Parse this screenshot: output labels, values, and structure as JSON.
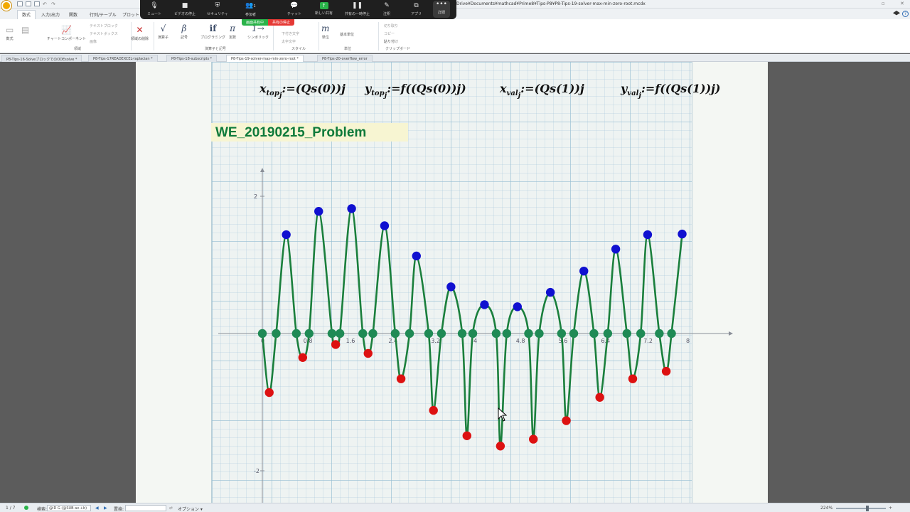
{
  "app": {
    "file_path": "Drive¥Documents¥mathcad¥Prime8¥Tips-P8¥P8-Tips-19-solver-max-min-zero-root.mcdx"
  },
  "ribbon_tabs": [
    "数式",
    "入力/出力",
    "関数",
    "行列/テーブル",
    "プロット"
  ],
  "ribbon": {
    "calc": [
      "数式",
      "テキストブロック",
      "チャートコンポーネント"
    ],
    "text_small": [
      "テキストブロック",
      "テキストボックス",
      "画像"
    ],
    "region_delete": "領域の削除",
    "operators": [
      {
        "icon": "√",
        "label": "演算子"
      },
      {
        "icon": "β",
        "label": "記号"
      },
      {
        "icon": "if",
        "label": "プログラミング"
      },
      {
        "icon": "π",
        "label": "定数"
      },
      {
        "icon": "1→",
        "label": "シンボリック"
      }
    ],
    "style_items": [
      "下付き文字",
      "太字文字"
    ],
    "units_label": "単位",
    "units_sub": "基本単位",
    "clipboard": [
      "切り取り",
      "コピー",
      "貼り付け"
    ],
    "groups": [
      "領域",
      "演算子と記号",
      "スタイル",
      "単位",
      "クリップボード"
    ]
  },
  "zoom_toolbar": {
    "items": [
      "ミュート",
      "ビデオの停止",
      "セキュリティ",
      "参加者",
      "チャット",
      "新しい共有",
      "共有の一時停止",
      "注釈",
      "アプリ",
      "詳細"
    ],
    "participants_count": "1",
    "share_status": "画面共有中",
    "stop_share": "共有の停止"
  },
  "doc_tabs": [
    "P8-Tips-16-SolveブロックでのODEsolve *",
    "P8-Tips-17READEXCEL-laplacian *",
    "P8-Tips-18-subscripts *",
    "P8-Tips-19-solver-max-min-zero-root *",
    "P8-Tips-20-overflow_error"
  ],
  "active_doc_tab": 3,
  "worksheet": {
    "equations": [
      {
        "lhs": "x",
        "lhs_sub": "top",
        "lhs_idx": "j",
        "rhs": ":=(Qs(0))j"
      },
      {
        "lhs": "y",
        "lhs_sub": "top",
        "lhs_idx": "j",
        "rhs": ":=f((Qs(0))j)"
      },
      {
        "lhs": "x",
        "lhs_sub": "val",
        "lhs_idx": "j",
        "rhs": ":=(Qs(1))j"
      },
      {
        "lhs": "y",
        "lhs_sub": "val",
        "lhs_idx": "j",
        "rhs": ":=f((Qs(1))j)"
      }
    ],
    "problem_title": "WE_20190215_Problem"
  },
  "chart_data": {
    "type": "scatter",
    "title": "",
    "xlabel": "",
    "ylabel": "",
    "xlim": [
      0,
      8
    ],
    "ylim": [
      -2.5,
      2.4
    ],
    "x_ticks": [
      "0",
      "0.8",
      "1.6",
      "2.4",
      "3.2",
      "4",
      "4.8",
      "5.6",
      "6.4",
      "7.2",
      "8"
    ],
    "y_ticks": [
      "2",
      "-2"
    ],
    "curve_color": "#1a7f3c",
    "series": [
      {
        "role": "curve",
        "color": "#1a7f3c"
      },
      {
        "role": "maxima",
        "color": "#1010d0",
        "x": [
          0.45,
          1.06,
          1.68,
          2.3,
          2.9,
          3.55,
          4.18,
          4.8,
          5.42,
          6.05,
          6.65,
          7.25,
          7.9
        ],
        "y": [
          1.44,
          1.78,
          1.82,
          1.57,
          1.13,
          0.68,
          0.42,
          0.39,
          0.6,
          0.91,
          1.23,
          1.44,
          1.45
        ]
      },
      {
        "role": "minima",
        "color": "#dd1111",
        "x": [
          0.13,
          0.76,
          1.38,
          1.99,
          2.61,
          3.22,
          3.85,
          4.48,
          5.1,
          5.72,
          6.35,
          6.97,
          7.6
        ],
        "y": [
          -0.86,
          -0.35,
          -0.16,
          -0.29,
          -0.66,
          -1.12,
          -1.49,
          -1.64,
          -1.54,
          -1.27,
          -0.93,
          -0.66,
          -0.55
        ]
      },
      {
        "role": "zeros",
        "color": "#1f8a55",
        "x": [
          0.0,
          0.26,
          0.64,
          0.88,
          1.31,
          1.46,
          1.89,
          2.08,
          2.5,
          2.77,
          3.13,
          3.37,
          3.76,
          3.96,
          4.4,
          4.6,
          5.01,
          5.21,
          5.63,
          5.86,
          6.24,
          6.5,
          6.86,
          7.12,
          7.47,
          7.7
        ],
        "y": [
          0,
          0,
          0,
          0,
          0,
          0,
          0,
          0,
          0,
          0,
          0,
          0,
          0,
          0,
          0,
          0,
          0,
          0,
          0,
          0,
          0,
          0,
          0,
          0,
          0,
          0
        ]
      }
    ]
  },
  "statusbar": {
    "page": "1 / 7",
    "search_label": "検索:",
    "search_value": "@ID G (@SUB ax⋅+b)",
    "replace_label": "置換:",
    "options": "オプション ▾",
    "zoom": "224%"
  }
}
